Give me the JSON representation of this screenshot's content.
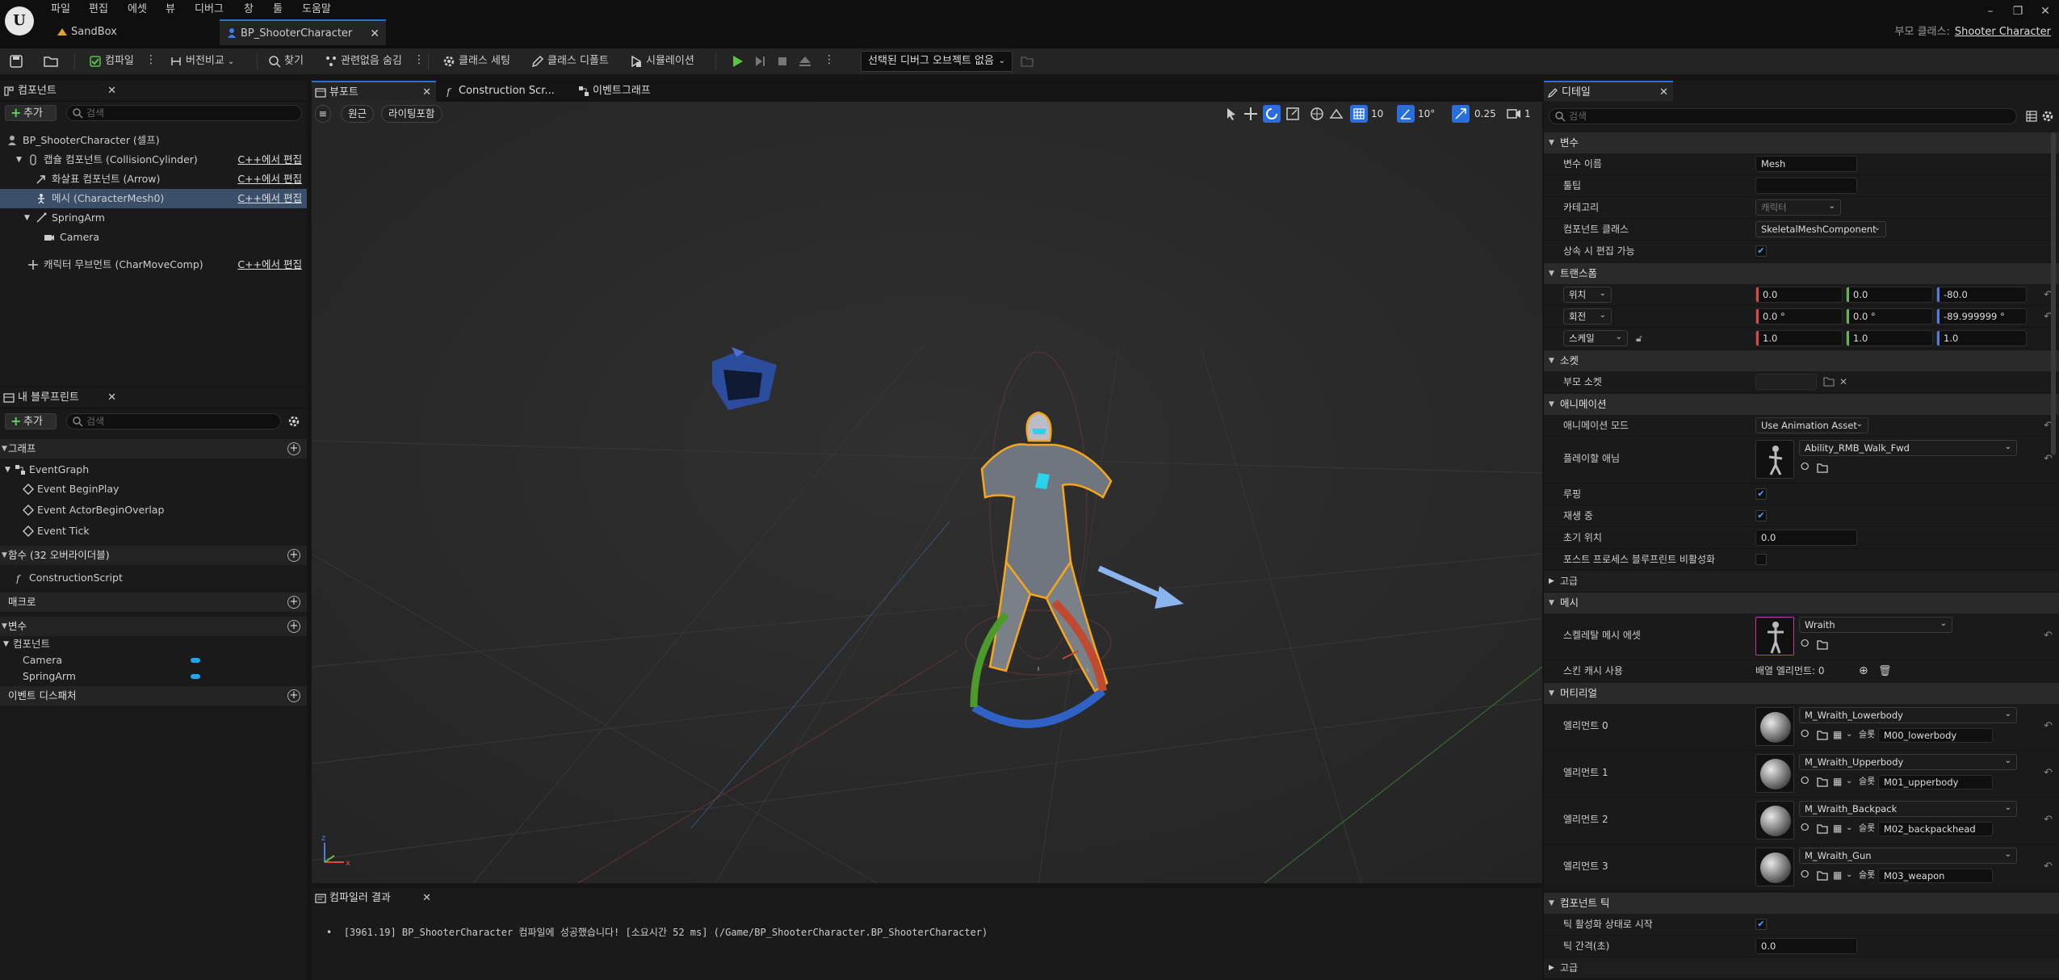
{
  "menu": [
    "파일",
    "편집",
    "에셋",
    "뷰",
    "디버그",
    "창",
    "툴",
    "도움말"
  ],
  "doc_tabs": [
    {
      "label": "SandBox",
      "active": false
    },
    {
      "label": "BP_ShooterCharacter",
      "active": true
    }
  ],
  "parent_class": {
    "label": "부모 클래스:",
    "value": "Shooter Character"
  },
  "toolbar": {
    "compile": "컴파일",
    "diff": "버전비교",
    "find": "찾기",
    "hide_unrelated": "관련없음 숨김",
    "class_settings": "클래스 세팅",
    "class_defaults": "클래스 디폴트",
    "simulation": "시뮬레이션",
    "debug_object": "선택된 디버그 오브젝트 없음"
  },
  "components_panel": {
    "title": "컴포넌트",
    "add": "추가",
    "search_placeholder": "검색",
    "rows": [
      {
        "label": "BP_ShooterCharacter (셀프)",
        "edit": ""
      },
      {
        "label": "캡슐 컴포넌트 (CollisionCylinder)",
        "edit": "C++에서 편집"
      },
      {
        "label": "화살표 컴포넌트 (Arrow)",
        "edit": "C++에서 편집"
      },
      {
        "label": "메시 (CharacterMesh0)",
        "edit": "C++에서 편집"
      },
      {
        "label": "SpringArm",
        "edit": ""
      },
      {
        "label": "Camera",
        "edit": ""
      },
      {
        "label": "캐릭터 무브먼트 (CharMoveComp)",
        "edit": "C++에서 편집"
      }
    ]
  },
  "my_blueprint": {
    "title": "내 블루프린트",
    "add": "추가",
    "search_placeholder": "검색",
    "graphs_header": "그래프",
    "event_graph": "EventGraph",
    "events": [
      "Event BeginPlay",
      "Event ActorBeginOverlap",
      "Event Tick"
    ],
    "functions_header": "함수 (32 오버라이더블)",
    "construction": "ConstructionScript",
    "macros_header": "매크로",
    "variables_header": "변수",
    "components_group": "컴포넌트",
    "variables": [
      "Camera",
      "SpringArm"
    ],
    "dispatchers_header": "이벤트 디스패처"
  },
  "center_tabs": [
    "뷰포트",
    "Construction Scr...",
    "이벤트그래프"
  ],
  "viewport": {
    "perspective": "원근",
    "lit": "라이팅포함",
    "grid_snap": "10",
    "rot_snap": "10°",
    "scale_snap": "0.25",
    "camera_speed": "1"
  },
  "compiler": {
    "title": "컴파일러 결과",
    "message": "[3961.19] BP_ShooterCharacter 컴파일에 성공했습니다! [소요시간 52 ms] (/Game/BP_ShooterCharacter.BP_ShooterCharacter)"
  },
  "details": {
    "title": "디테일",
    "search_placeholder": "검색",
    "sec_variable": "변수",
    "var_name_label": "변수 이름",
    "var_name": "Mesh",
    "tooltip_label": "툴팁",
    "category_label": "카테고리",
    "category": "캐릭터",
    "comp_class_label": "컴포넌트 클래스",
    "comp_class": "SkeletalMeshComponent",
    "editable_label": "상속 시 편집 가능",
    "sec_transform": "트랜스폼",
    "location_label": "위치",
    "location": [
      "0.0",
      "0.0",
      "-80.0"
    ],
    "rotation_label": "회전",
    "rotation": [
      "0.0 °",
      "0.0 °",
      "-89.999999 °"
    ],
    "scale_label": "스케일",
    "scale": [
      "1.0",
      "1.0",
      "1.0"
    ],
    "sec_sockets": "소켓",
    "parent_socket_label": "부모 소켓",
    "sec_animation": "애니메이션",
    "anim_mode_label": "애니메이션 모드",
    "anim_mode": "Use Animation Asset",
    "anim_to_play_label": "플레이할 애님",
    "anim_to_play": "Ability_RMB_Walk_Fwd",
    "looping_label": "루핑",
    "playing_label": "재생 중",
    "initial_pos_label": "초기 위치",
    "initial_pos": "0.0",
    "disable_post_label": "포스트 프로세스 블루프린트 비활성화",
    "advanced": "고급",
    "sec_mesh": "메시",
    "skel_mesh_label": "스켈레탈 메시 에셋",
    "skel_mesh": "Wraith",
    "skin_cache_label": "스킨 캐시 사용",
    "array_elements": "배열 엘리먼트: 0",
    "sec_materials": "머티리얼",
    "slot_label": "슬롯",
    "materials": [
      {
        "label": "엘리먼트 0",
        "name": "M_Wraith_Lowerbody",
        "slot": "M00_lowerbody"
      },
      {
        "label": "엘리먼트 1",
        "name": "M_Wraith_Upperbody",
        "slot": "M01_upperbody"
      },
      {
        "label": "엘리먼트 2",
        "name": "M_Wraith_Backpack",
        "slot": "M02_backpackhead"
      },
      {
        "label": "엘리먼트 3",
        "name": "M_Wraith_Gun",
        "slot": "M03_weapon"
      }
    ],
    "sec_component_tick": "컴포넌트 틱",
    "tick_start_label": "틱 활성화 상태로 시작",
    "tick_interval_label": "틱 간격(초)",
    "tick_interval": "0.0",
    "advanced2": "고급"
  },
  "colors": {
    "accent": "#2a6ede",
    "x_axis": "#e04848",
    "y_axis": "#62b64f",
    "z_axis": "#4a7fe0",
    "play": "#55c543",
    "selection": "#f6a61b"
  }
}
